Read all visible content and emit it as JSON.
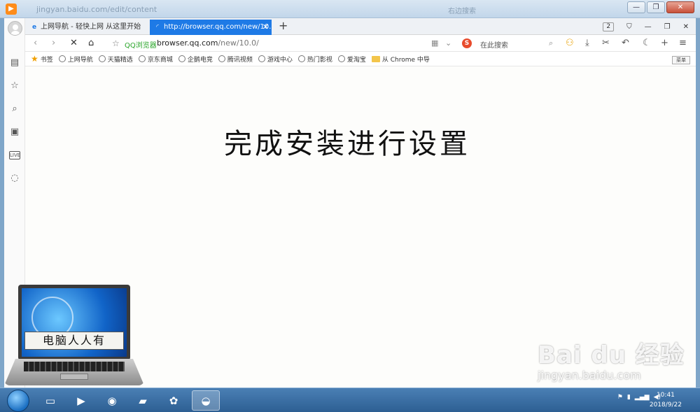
{
  "titlebar": {
    "url_text": "jingyan.baidu.com/edit/content",
    "right_text": "右边搜索"
  },
  "tabs": [
    {
      "label": "上网导航 - 轻快上网 从这里开始"
    },
    {
      "label": "http://browser.qq.com/new/10.0/"
    }
  ],
  "tabbar": {
    "count": "2"
  },
  "address": {
    "brand": "QQ浏览器",
    "host": "browser.qq.com",
    "path": "/new/10.0/"
  },
  "search": {
    "placeholder": "在此搜索"
  },
  "bookmarks": {
    "label": "书签",
    "items": [
      "上网导航",
      "天猫精选",
      "京东商城",
      "企鹅电竞",
      "腾讯视频",
      "游戏中心",
      "热门影视",
      "爱淘宝"
    ],
    "folder": "从 Chrome 中导"
  },
  "tooltip": "菜单",
  "headline": "完成安装进行设置",
  "laptop_label": "电脑人人有",
  "clock": {
    "time": "10:41",
    "date": "2018/9/22"
  },
  "watermark": {
    "logo": "Bai du 经验",
    "url": "jingyan.baidu.com"
  }
}
